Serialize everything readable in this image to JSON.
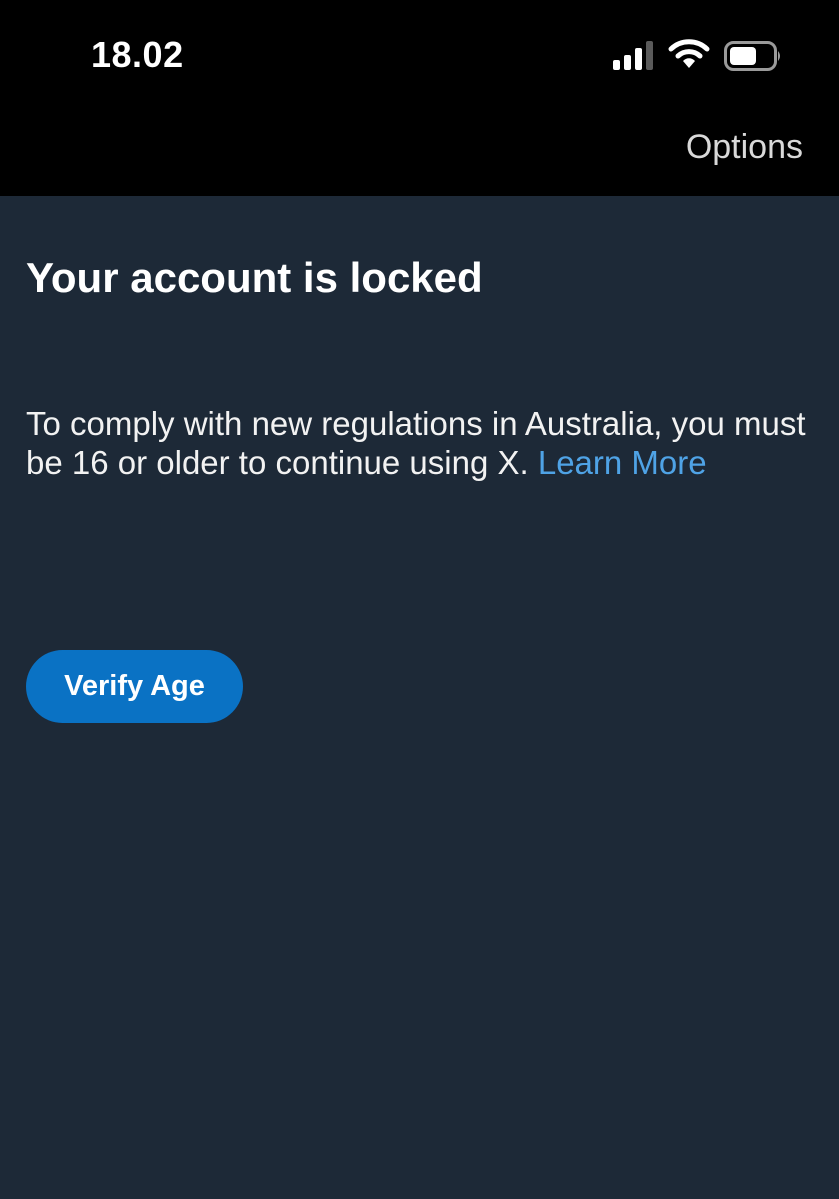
{
  "status_bar": {
    "time": "18.02",
    "icons": [
      "cellular-signal-icon",
      "wifi-icon",
      "battery-icon"
    ]
  },
  "nav": {
    "options_label": "Options"
  },
  "content": {
    "title": "Your account is locked",
    "message_text": "To comply with new regulations in Australia, you must be 16 or older to continue using X.",
    "learn_more_label": "Learn More",
    "verify_button_label": "Verify Age"
  },
  "colors": {
    "background": "#1d2937",
    "top_bar": "#000000",
    "link": "#4fa3e6",
    "primary_button": "#0a72c4"
  }
}
